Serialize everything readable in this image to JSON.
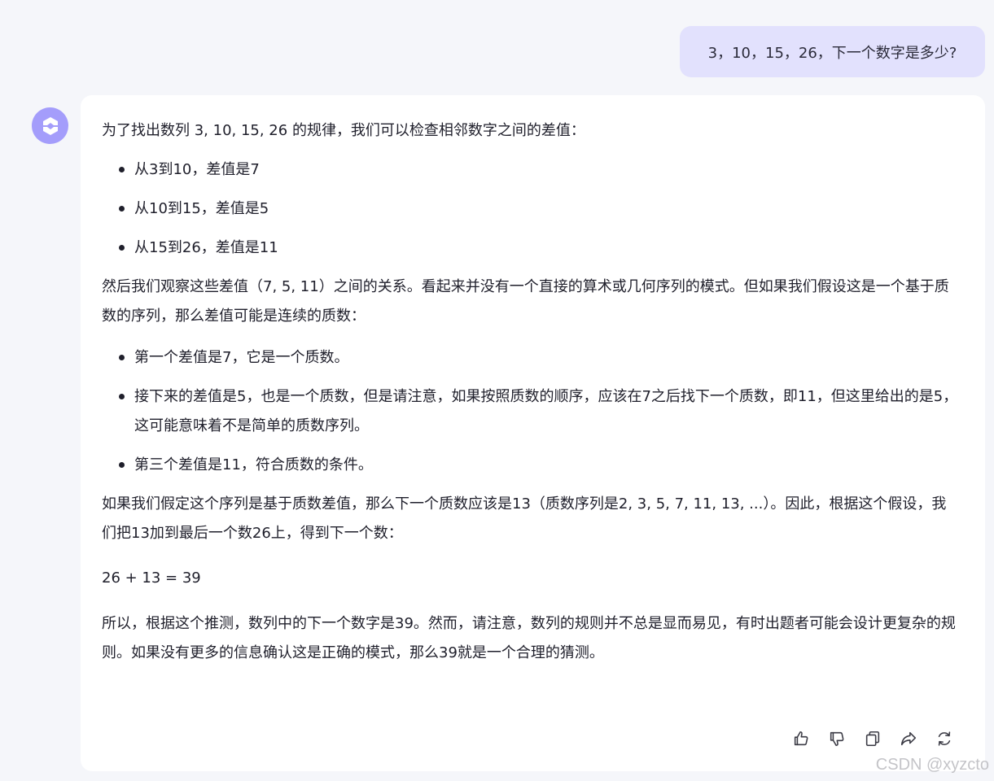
{
  "user_message": "3，10，15，26，下一个数字是多少?",
  "assistant": {
    "intro": "为了找出数列 3, 10, 15, 26 的规律，我们可以检查相邻数字之间的差值：",
    "differences": [
      "从3到10，差值是7",
      "从10到15，差值是5",
      "从15到26，差值是11"
    ],
    "paragraph2": "然后我们观察这些差值（7, 5, 11）之间的关系。看起来并没有一个直接的算术或几何序列的模式。但如果我们假设这是一个基于质数的序列，那么差值可能是连续的质数：",
    "prime_points": [
      "第一个差值是7，它是一个质数。",
      "接下来的差值是5，也是一个质数，但是请注意，如果按照质数的顺序，应该在7之后找下一个质数，即11，但这里给出的是5，这可能意味着不是简单的质数序列。",
      "第三个差值是11，符合质数的条件。"
    ],
    "paragraph3": "如果我们假定这个序列是基于质数差值，那么下一个质数应该是13（质数序列是2, 3, 5, 7, 11, 13, ...）。因此，根据这个假设，我们把13加到最后一个数26上，得到下一个数：",
    "equation": "26 + 13 = 39",
    "conclusion": "所以，根据这个推测，数列中的下一个数字是39。然而，请注意，数列的规则并不总是显而易见，有时出题者可能会设计更复杂的规则。如果没有更多的信息确认这是正确的模式，那么39就是一个合理的猜测。"
  },
  "toolbar": {
    "icons": [
      "thumbs-up-icon",
      "thumbs-down-icon",
      "copy-icon",
      "share-icon",
      "regenerate-icon"
    ]
  },
  "watermark": "CSDN @xyzcto",
  "colors": {
    "background": "#f5f6fa",
    "user_bubble": "#e2e1fd",
    "avatar": "#a49dfb",
    "card": "#ffffff"
  }
}
